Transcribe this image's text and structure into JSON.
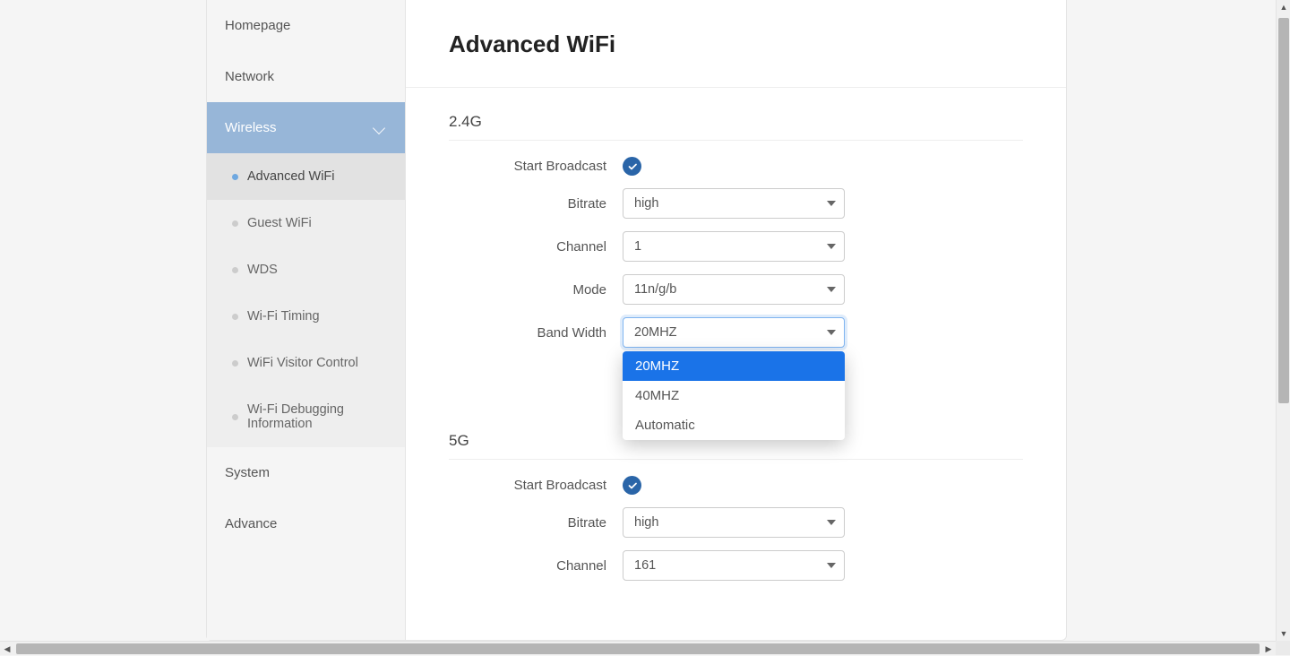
{
  "page": {
    "title": "Advanced WiFi"
  },
  "sidebar": {
    "items": [
      {
        "label": "Homepage"
      },
      {
        "label": "Network"
      },
      {
        "label": "Wireless",
        "expanded": true,
        "children": [
          {
            "label": "Advanced WiFi",
            "active": true
          },
          {
            "label": "Guest WiFi"
          },
          {
            "label": "WDS"
          },
          {
            "label": "Wi-Fi Timing"
          },
          {
            "label": "WiFi Visitor Control"
          },
          {
            "label": "Wi-Fi Debugging Information"
          }
        ]
      },
      {
        "label": "System"
      },
      {
        "label": "Advance"
      }
    ]
  },
  "sections": {
    "g24": {
      "title": "2.4G",
      "labels": {
        "broadcast": "Start Broadcast",
        "bitrate": "Bitrate",
        "channel": "Channel",
        "mode": "Mode",
        "bandwidth": "Band Width"
      },
      "values": {
        "broadcast": true,
        "bitrate": "high",
        "channel": "1",
        "mode": "11n/g/b",
        "bandwidth": "20MHZ"
      },
      "bandwidth_options": [
        "20MHZ",
        "40MHZ",
        "Automatic"
      ]
    },
    "g5": {
      "title": "5G",
      "labels": {
        "broadcast": "Start Broadcast",
        "bitrate": "Bitrate",
        "channel": "Channel"
      },
      "values": {
        "broadcast": true,
        "bitrate": "high",
        "channel": "161"
      }
    }
  },
  "colors": {
    "accent": "#2a65a8",
    "nav_active": "#97b6d8",
    "option_selected": "#1a73e8"
  }
}
